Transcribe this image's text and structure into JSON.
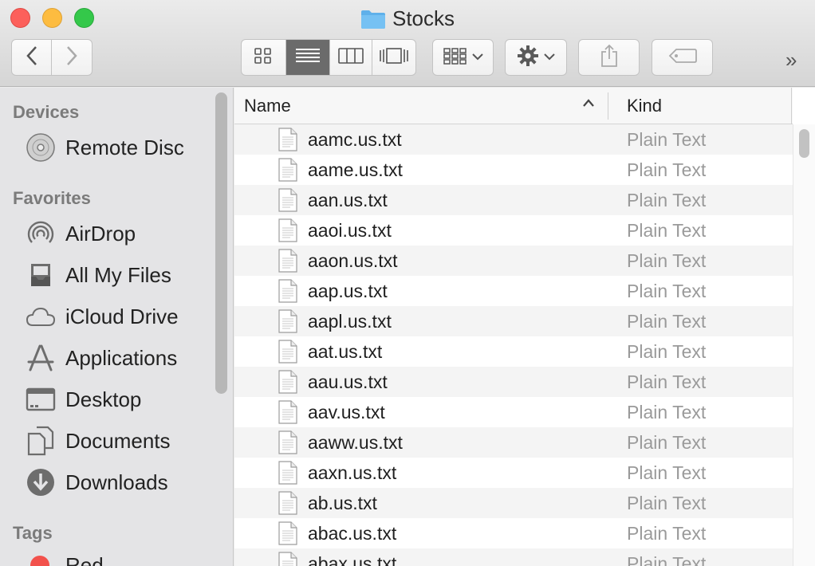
{
  "window": {
    "title": "Stocks"
  },
  "toolbar": {
    "back_icon": "chevron-left-icon",
    "forward_icon": "chevron-right-icon",
    "view_modes": [
      "icon-view",
      "list-view",
      "column-view",
      "cover-flow-view"
    ],
    "active_view": "list-view",
    "arrange_icon": "arrange-grid-icon",
    "action_icon": "gear-icon",
    "share_icon": "share-icon",
    "tags_icon": "tag-icon",
    "overflow": "»"
  },
  "sidebar": {
    "sections": [
      {
        "header": "Devices",
        "items": [
          {
            "label": "Remote Disc",
            "icon": "disc-icon"
          }
        ]
      },
      {
        "header": "Favorites",
        "items": [
          {
            "label": "AirDrop",
            "icon": "airdrop-icon"
          },
          {
            "label": "All My Files",
            "icon": "all-files-icon"
          },
          {
            "label": "iCloud Drive",
            "icon": "cloud-icon"
          },
          {
            "label": "Applications",
            "icon": "applications-icon"
          },
          {
            "label": "Desktop",
            "icon": "desktop-icon"
          },
          {
            "label": "Documents",
            "icon": "documents-icon"
          },
          {
            "label": "Downloads",
            "icon": "download-icon"
          }
        ]
      },
      {
        "header": "Tags",
        "items": [
          {
            "label": "Red",
            "icon": "red-tag-dot",
            "color": "#f2514c"
          }
        ]
      }
    ]
  },
  "list": {
    "columns": {
      "name": "Name",
      "kind": "Kind"
    },
    "sort": {
      "column": "name",
      "direction": "ascending"
    },
    "rows": [
      {
        "name": "aamc.us.txt",
        "kind": "Plain Text"
      },
      {
        "name": "aame.us.txt",
        "kind": "Plain Text"
      },
      {
        "name": "aan.us.txt",
        "kind": "Plain Text"
      },
      {
        "name": "aaoi.us.txt",
        "kind": "Plain Text"
      },
      {
        "name": "aaon.us.txt",
        "kind": "Plain Text"
      },
      {
        "name": "aap.us.txt",
        "kind": "Plain Text"
      },
      {
        "name": "aapl.us.txt",
        "kind": "Plain Text"
      },
      {
        "name": "aat.us.txt",
        "kind": "Plain Text"
      },
      {
        "name": "aau.us.txt",
        "kind": "Plain Text"
      },
      {
        "name": "aav.us.txt",
        "kind": "Plain Text"
      },
      {
        "name": "aaww.us.txt",
        "kind": "Plain Text"
      },
      {
        "name": "aaxn.us.txt",
        "kind": "Plain Text"
      },
      {
        "name": "ab.us.txt",
        "kind": "Plain Text"
      },
      {
        "name": "abac.us.txt",
        "kind": "Plain Text"
      },
      {
        "name": "abax.us.txt",
        "kind": "Plain Text"
      }
    ]
  }
}
